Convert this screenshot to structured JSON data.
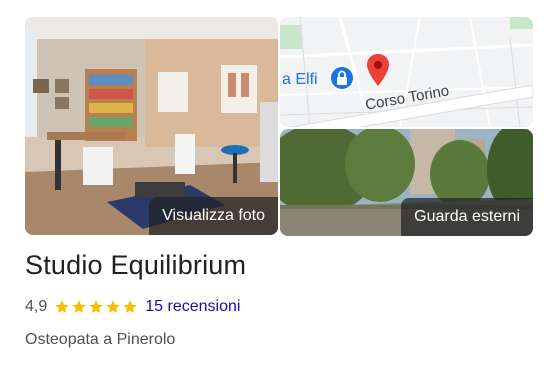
{
  "photos": {
    "main_label": "Visualizza foto",
    "street_label": "Guarda esterni"
  },
  "map": {
    "street_name": "Corso Torino",
    "place_label": "a Elfi",
    "pin_color": "#ea4335",
    "lock_color": "#1a73e8"
  },
  "business": {
    "name": "Studio Equilibrium",
    "rating": "4,9",
    "stars": 5,
    "reviews": "15 recensioni",
    "category": "Osteopata a Pinerolo"
  },
  "colors": {
    "link": "#1a0dab",
    "star": "#fbbc04",
    "text": "#202124",
    "secondary": "#4d5156"
  }
}
